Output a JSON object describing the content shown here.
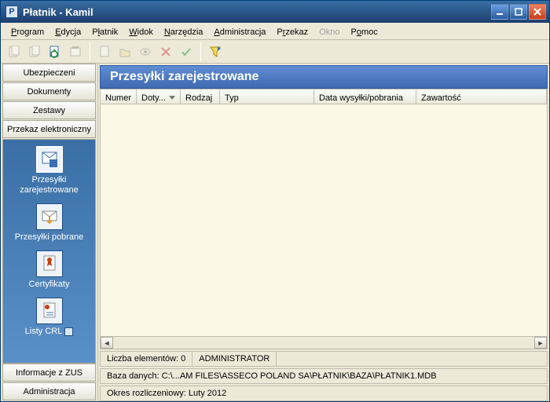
{
  "window": {
    "title": "Płatnik - Kamil"
  },
  "menu": {
    "program": "Program",
    "edycja": "Edycja",
    "platnik": "Płatnik",
    "widok": "Widok",
    "narzedzia": "Narzędzia",
    "administracja": "Administracja",
    "przekaz": "Przekaz",
    "okno": "Okno",
    "pomoc": "Pomoc"
  },
  "sidebar": {
    "ubezpieczeni": "Ubezpieczeni",
    "dokumenty": "Dokumenty",
    "zestawy": "Zestawy",
    "przekaz": "Przekaz elektroniczny",
    "informacje": "Informacje z ZUS",
    "administracja": "Administracja",
    "nav": {
      "rejestrowane1": "Przesyłki",
      "rejestrowane2": "zarejestrowane",
      "pobrane": "Przesyłki pobrane",
      "certyfikaty": "Certyfikaty",
      "listy": "Listy CRL"
    }
  },
  "main": {
    "title": "Przesyłki zarejestrowane",
    "cols": {
      "numer": "Numer",
      "doty": "Doty...",
      "rodzaj": "Rodzaj",
      "typ": "Typ",
      "data": "Data wysyłki/pobrania",
      "zawartosc": "Zawartość"
    }
  },
  "status": {
    "count_label": "Liczba elementów:",
    "count_value": "0",
    "user": "ADMINISTRATOR",
    "db_label": "Baza danych:",
    "db_path": "C:\\...AM FILES\\ASSECO POLAND SA\\PŁATNIK\\BAZA\\PŁATNIK1.MDB",
    "period_label": "Okres rozliczeniowy:",
    "period_value": "Luty 2012"
  }
}
